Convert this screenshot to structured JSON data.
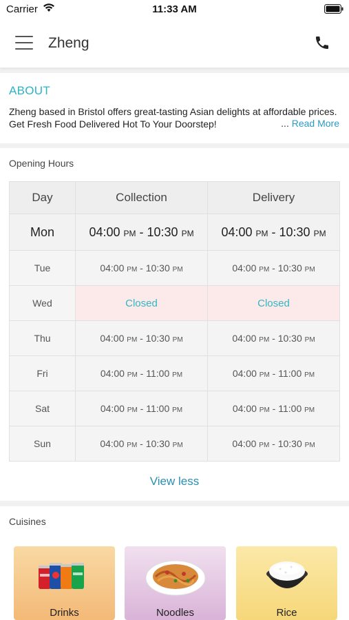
{
  "status_bar": {
    "carrier": "Carrier",
    "time": "11:33 AM"
  },
  "header": {
    "title": "Zheng",
    "menu_icon": "hamburger-menu-icon",
    "phone_icon": "phone-icon"
  },
  "about": {
    "heading": "ABOUT",
    "description": "Zheng based in Bristol offers great-tasting Asian delights at affordable prices. Get Fresh Food Delivered Hot To Your Doorstep!",
    "read_more_ellipsis": "...",
    "read_more": "Read More"
  },
  "opening_hours": {
    "label": "Opening Hours",
    "columns": [
      "Day",
      "Collection",
      "Delivery"
    ],
    "rows": [
      {
        "day": "Mon",
        "collection": [
          "04:00",
          "PM",
          " - 10:30",
          "PM"
        ],
        "delivery": [
          "04:00",
          "PM",
          " - 10:30",
          "PM"
        ]
      },
      {
        "day": "Tue",
        "collection": [
          "04:00",
          "PM",
          " - 10:30",
          "PM"
        ],
        "delivery": [
          "04:00",
          "PM",
          " - 10:30",
          "PM"
        ]
      },
      {
        "day": "Wed",
        "collection_closed": "Closed",
        "delivery_closed": "Closed"
      },
      {
        "day": "Thu",
        "collection": [
          "04:00",
          "PM",
          " - 10:30",
          "PM"
        ],
        "delivery": [
          "04:00",
          "PM",
          " - 10:30",
          "PM"
        ]
      },
      {
        "day": "Fri",
        "collection": [
          "04:00",
          "PM",
          " - 11:00",
          "PM"
        ],
        "delivery": [
          "04:00",
          "PM",
          " - 11:00",
          "PM"
        ]
      },
      {
        "day": "Sat",
        "collection": [
          "04:00",
          "PM",
          " - 11:00",
          "PM"
        ],
        "delivery": [
          "04:00",
          "PM",
          " - 11:00",
          "PM"
        ]
      },
      {
        "day": "Sun",
        "collection": [
          "04:00",
          "PM",
          " - 10:30",
          "PM"
        ],
        "delivery": [
          "04:00",
          "PM",
          " - 10:30",
          "PM"
        ]
      }
    ],
    "view_less": "View less"
  },
  "cuisines": {
    "label": "Cuisines",
    "items": [
      {
        "name": "Drinks",
        "icon": "soda-cans-icon"
      },
      {
        "name": "Noodles",
        "icon": "noodles-plate-icon"
      },
      {
        "name": "Rice",
        "icon": "rice-bowl-icon"
      }
    ]
  },
  "colors": {
    "accent": "#2cb4c4",
    "link": "#2a9bc4",
    "closed_bg": "#fce9ea"
  }
}
